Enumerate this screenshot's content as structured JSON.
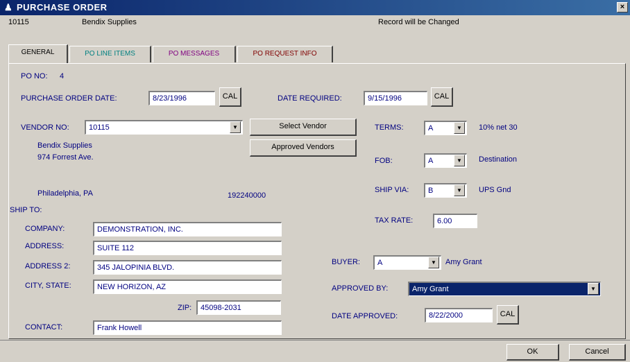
{
  "window": {
    "title": "PURCHASE ORDER",
    "close_glyph": "×",
    "title_icon": "♟"
  },
  "header": {
    "vendor_code": "10115",
    "vendor_name": "Bendix Supplies",
    "record_status": "Record will be Changed"
  },
  "tabs": [
    {
      "label": "GENERAL",
      "color": "#000000",
      "active": true
    },
    {
      "label": "PO LINE ITEMS",
      "color": "#008080",
      "active": false
    },
    {
      "label": "PO MESSAGES",
      "color": "#800080",
      "active": false
    },
    {
      "label": "PO REQUEST INFO",
      "color": "#800000",
      "active": false
    }
  ],
  "general": {
    "po_no_label": "PO NO:",
    "po_no_value": "4",
    "po_date_label": "PURCHASE ORDER DATE:",
    "po_date_value": "8/23/1996",
    "cal_label": "CAL",
    "date_required_label": "DATE REQUIRED:",
    "date_required_value": "9/15/1996",
    "vendor_no_label": "VENDOR NO:",
    "vendor_no_value": "10115",
    "select_vendor_label": "Select Vendor",
    "approved_vendors_label": "Approved Vendors",
    "vendor_address_name": "Bendix Supplies",
    "vendor_address_street": "974 Forrest Ave.",
    "vendor_address_city": "Philadelphia, PA",
    "vendor_address_zip": "192240000",
    "terms_label": "TERMS:",
    "terms_value": "A",
    "terms_desc": "10% net 30",
    "fob_label": "FOB:",
    "fob_value": "A",
    "fob_desc": "Destination",
    "ship_via_label": "SHIP VIA:",
    "ship_via_value": "B",
    "ship_via_desc": "UPS Gnd",
    "tax_rate_label": "TAX RATE:",
    "tax_rate_value": "6.00",
    "ship_to_label": "SHIP TO:",
    "company_label": "COMPANY:",
    "company_value": "DEMONSTRATION, INC.",
    "address_label": "ADDRESS:",
    "address_value": "SUITE 112",
    "address2_label": "ADDRESS 2:",
    "address2_value": "345 JALOPINIA BLVD.",
    "city_state_label": "CITY, STATE:",
    "city_state_value": "NEW HORIZON, AZ",
    "zip_label": "ZIP:",
    "zip_value": "45098-2031",
    "contact_label": "CONTACT:",
    "contact_value": "Frank Howell",
    "buyer_label": "BUYER:",
    "buyer_value": "A",
    "buyer_desc": "Amy Grant",
    "approved_by_label": "APPROVED BY:",
    "approved_by_value": "Amy Grant",
    "date_approved_label": "DATE APPROVED:",
    "date_approved_value": "8/22/2000"
  },
  "footer": {
    "ok_label": "OK",
    "cancel_label": "Cancel"
  },
  "dropdown_glyph": "▼"
}
